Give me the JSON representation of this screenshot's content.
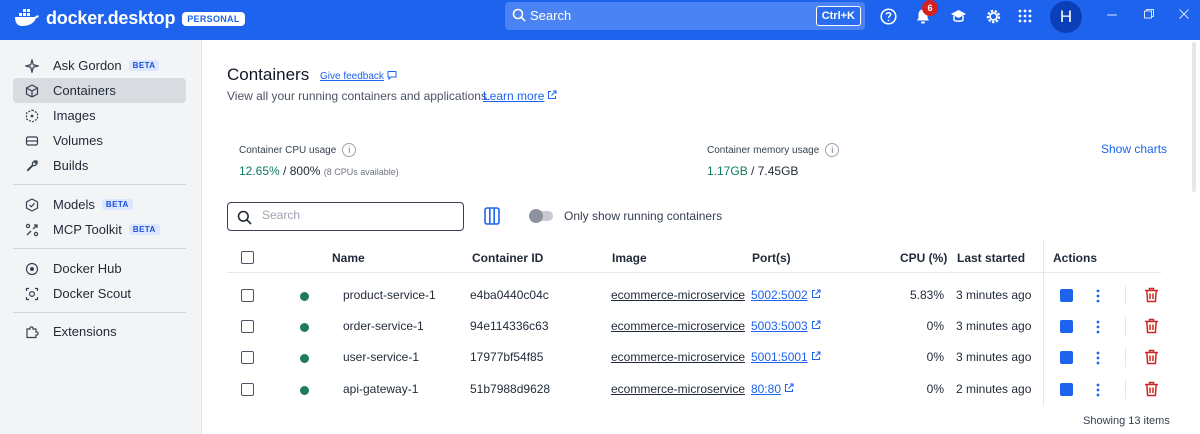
{
  "titlebar": {
    "logo_text": "docker.desktop",
    "plan_badge": "PERSONAL",
    "search_label": "Search",
    "search_shortcut": "Ctrl+K",
    "notification_count": "6",
    "avatar_initial": "H"
  },
  "sidebar": {
    "items": [
      {
        "label": "Ask Gordon",
        "badge": "BETA",
        "icon": "sparkle-icon"
      },
      {
        "label": "Containers",
        "active": true,
        "icon": "container-cube-icon"
      },
      {
        "label": "Images",
        "icon": "image-layers-icon"
      },
      {
        "label": "Volumes",
        "icon": "volume-disk-icon"
      },
      {
        "label": "Builds",
        "icon": "wrench-icon"
      },
      {
        "label": "Models",
        "badge": "BETA",
        "icon": "model-cube-icon"
      },
      {
        "label": "MCP Toolkit",
        "badge": "BETA",
        "icon": "toolkit-icon"
      },
      {
        "label": "Docker Hub",
        "icon": "hub-icon"
      },
      {
        "label": "Docker Scout",
        "icon": "scout-icon"
      },
      {
        "label": "Extensions",
        "icon": "puzzle-icon"
      }
    ]
  },
  "page": {
    "title": "Containers",
    "feedback": "Give feedback",
    "subtitle": "View all your running containers and applications.",
    "learn_more": "Learn more"
  },
  "stats": {
    "cpu_label": "Container CPU usage",
    "cpu_value": "12.65%",
    "cpu_total": "/ 800%",
    "cpu_note": "(8 CPUs available)",
    "mem_label": "Container memory usage",
    "mem_value": "1.17GB",
    "mem_total": "/ 7.45GB",
    "show_charts": "Show charts"
  },
  "toolbar": {
    "search_placeholder": "Search",
    "toggle_label": "Only show running containers"
  },
  "table": {
    "columns": {
      "name": "Name",
      "id": "Container ID",
      "image": "Image",
      "ports": "Port(s)",
      "cpu": "CPU (%)",
      "last_started": "Last started",
      "actions": "Actions"
    },
    "rows": [
      {
        "name": "product-service-1",
        "id": "e4ba0440c04c",
        "image": "ecommerce-microservice-product-service",
        "port": "5002:5002",
        "cpu": "5.83%",
        "last_started": "3 minutes ago"
      },
      {
        "name": "order-service-1",
        "id": "94e114336c63",
        "image": "ecommerce-microservice-order-service",
        "port": "5003:5003",
        "cpu": "0%",
        "last_started": "3 minutes ago"
      },
      {
        "name": "user-service-1",
        "id": "17977bf54f85",
        "image": "ecommerce-microservice-user-service",
        "port": "5001:5001",
        "cpu": "0%",
        "last_started": "3 minutes ago"
      },
      {
        "name": "api-gateway-1",
        "id": "51b7988d9628",
        "image": "ecommerce-microservice-api-gateway",
        "port": "80:80",
        "cpu": "0%",
        "last_started": "2 minutes ago"
      }
    ],
    "footer": "Showing 13 items"
  },
  "colors": {
    "brand": "#1d63ed",
    "running": "#1f7a62",
    "delete": "#d42222"
  }
}
